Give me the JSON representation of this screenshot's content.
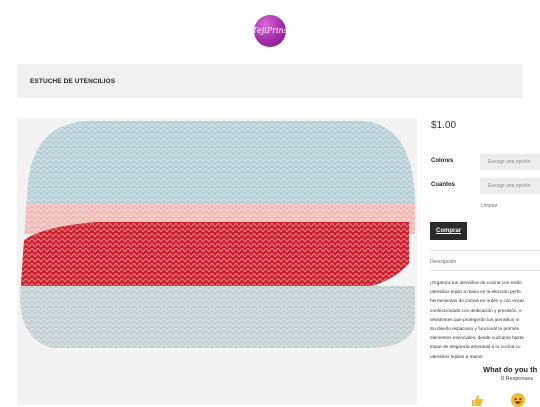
{
  "logo": {
    "text": "TejiPrins",
    "tagline": ""
  },
  "product": {
    "title": "ESTUCHE DE UTENCILIOS",
    "price": "$1.00"
  },
  "options": [
    {
      "label": "Colores",
      "placeholder": "Escoge una opción"
    },
    {
      "label": "Cuantos",
      "placeholder": "Escoge una opción"
    }
  ],
  "clear_label": "Limpiar",
  "buy_label": "Comprar",
  "description": {
    "tab_label": "Descripción",
    "lines": [
      "¡Organiza tus utensilios de cocina con estilo",
      "utensilios tejido a mano es la elección perfe",
      "herramientas de cocina en orden y con encar",
      "confeccionado con dedicación y precisión, e",
      "resistentes que protegerán tus utensilios m",
      "Su diseño espacioso y funcional te permite",
      "elementos esenciales, desde cucharas hasta",
      "toque de elegancia artesanal a tu cocina co",
      "utensilios tejidos a mano!"
    ]
  },
  "reactions": {
    "title": "What do you th",
    "count": "0 Responses",
    "emojis": [
      "thumbs-up-icon",
      "laughing-face-icon"
    ]
  },
  "colors": {
    "logo_purple": "#a22ba6",
    "button_dark": "#2b2b2b",
    "title_bar_bg": "#f0f0f0",
    "crochet_blue": "#b7cfd6",
    "crochet_pink": "#f1b9b5",
    "crochet_red": "#cc1f2c"
  }
}
